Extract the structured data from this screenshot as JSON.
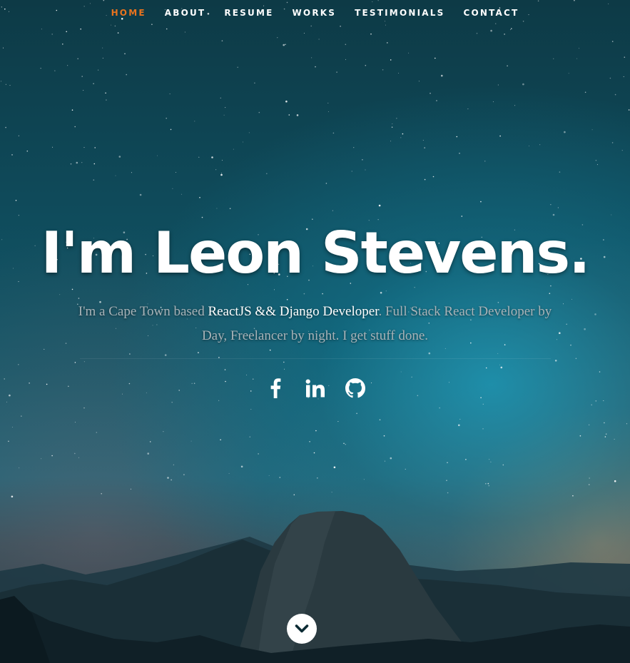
{
  "nav": {
    "items": [
      {
        "label": "HOME",
        "active": true
      },
      {
        "label": "ABOUT",
        "active": false
      },
      {
        "label": "RESUME",
        "active": false
      },
      {
        "label": "WORKS",
        "active": false
      },
      {
        "label": "TESTIMONIALS",
        "active": false
      },
      {
        "label": "CONTACT",
        "active": false
      }
    ],
    "active_color": "#e8731e"
  },
  "banner": {
    "headline": "I'm Leon Stevens.",
    "intro_prefix": "I'm a Cape Town based ",
    "intro_highlight": "ReactJS && Django Developer",
    "intro_suffix": ". Full Stack React Developer by Day, Freelancer by night. I get stuff done."
  },
  "social": [
    {
      "name": "facebook-icon"
    },
    {
      "name": "linkedin-icon"
    },
    {
      "name": "github-icon"
    }
  ],
  "scroll_down": {
    "icon": "chevron-down-icon"
  }
}
